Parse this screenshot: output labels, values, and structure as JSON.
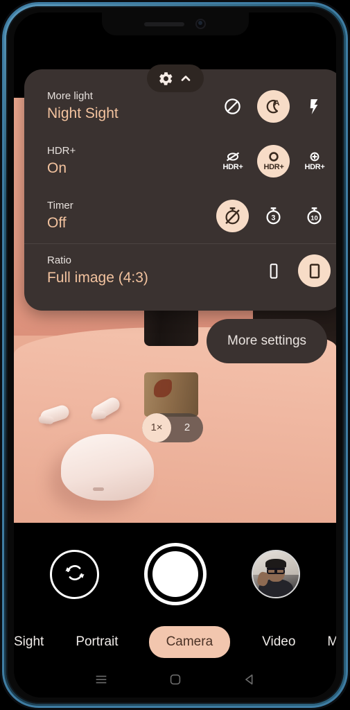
{
  "device": {
    "notch": {
      "speaker": "speaker-grille",
      "camera": "front-camera"
    }
  },
  "top_bar": {
    "settings_gear_icon": "gear-icon",
    "collapse_chevron_icon": "chevron-up-icon"
  },
  "settings_panel": {
    "rows": [
      {
        "label": "More light",
        "value": "Night Sight",
        "options": [
          {
            "icon": "night-sight-off-icon",
            "selected": false
          },
          {
            "icon": "night-sight-auto-icon",
            "selected": true
          },
          {
            "icon": "night-sight-on-icon",
            "selected": false
          }
        ]
      },
      {
        "label": "HDR+",
        "value": "On",
        "options": [
          {
            "icon": "hdr-off-icon",
            "label": "HDR+",
            "selected": false
          },
          {
            "icon": "hdr-on-icon",
            "label": "HDR+",
            "selected": true
          },
          {
            "icon": "hdr-enhanced-icon",
            "label": "HDR+",
            "selected": false
          }
        ]
      },
      {
        "label": "Timer",
        "value": "Off",
        "options": [
          {
            "icon": "timer-off-icon",
            "selected": true
          },
          {
            "icon": "timer-3s-icon",
            "label": "3",
            "selected": false
          },
          {
            "icon": "timer-10s-icon",
            "label": "10",
            "selected": false
          }
        ]
      },
      {
        "label": "Ratio",
        "value": "Full image (4:3)",
        "options": [
          {
            "icon": "ratio-full-screen-icon",
            "selected": false
          },
          {
            "icon": "ratio-4-3-icon",
            "selected": true
          }
        ]
      }
    ]
  },
  "more_settings": {
    "label": "More settings"
  },
  "zoom_control": {
    "options": [
      {
        "label": "1×",
        "active": true
      },
      {
        "label": "2",
        "active": false
      }
    ]
  },
  "camera_controls": {
    "switch_camera_icon": "switch-camera-icon",
    "shutter_icon": "shutter-button-icon",
    "gallery_icon": "gallery-thumbnail"
  },
  "mode_selector": {
    "modes": [
      {
        "label": "Sight",
        "selected": false,
        "truncated": true
      },
      {
        "label": "Portrait",
        "selected": false,
        "truncated": false
      },
      {
        "label": "Camera",
        "selected": true,
        "truncated": false
      },
      {
        "label": "Video",
        "selected": false,
        "truncated": false
      },
      {
        "label": "Modes",
        "selected": false,
        "truncated": false
      }
    ]
  },
  "nav_bar": {
    "recents_icon": "recents-icon",
    "home_icon": "home-icon",
    "back_icon": "back-icon"
  },
  "colors": {
    "accent_peach": "#f7dcc7",
    "panel_bg": "#3a3230",
    "value_text": "#f3c39f",
    "mode_pill": "#f2c6ae",
    "frame_blue": "#3f7da3"
  }
}
